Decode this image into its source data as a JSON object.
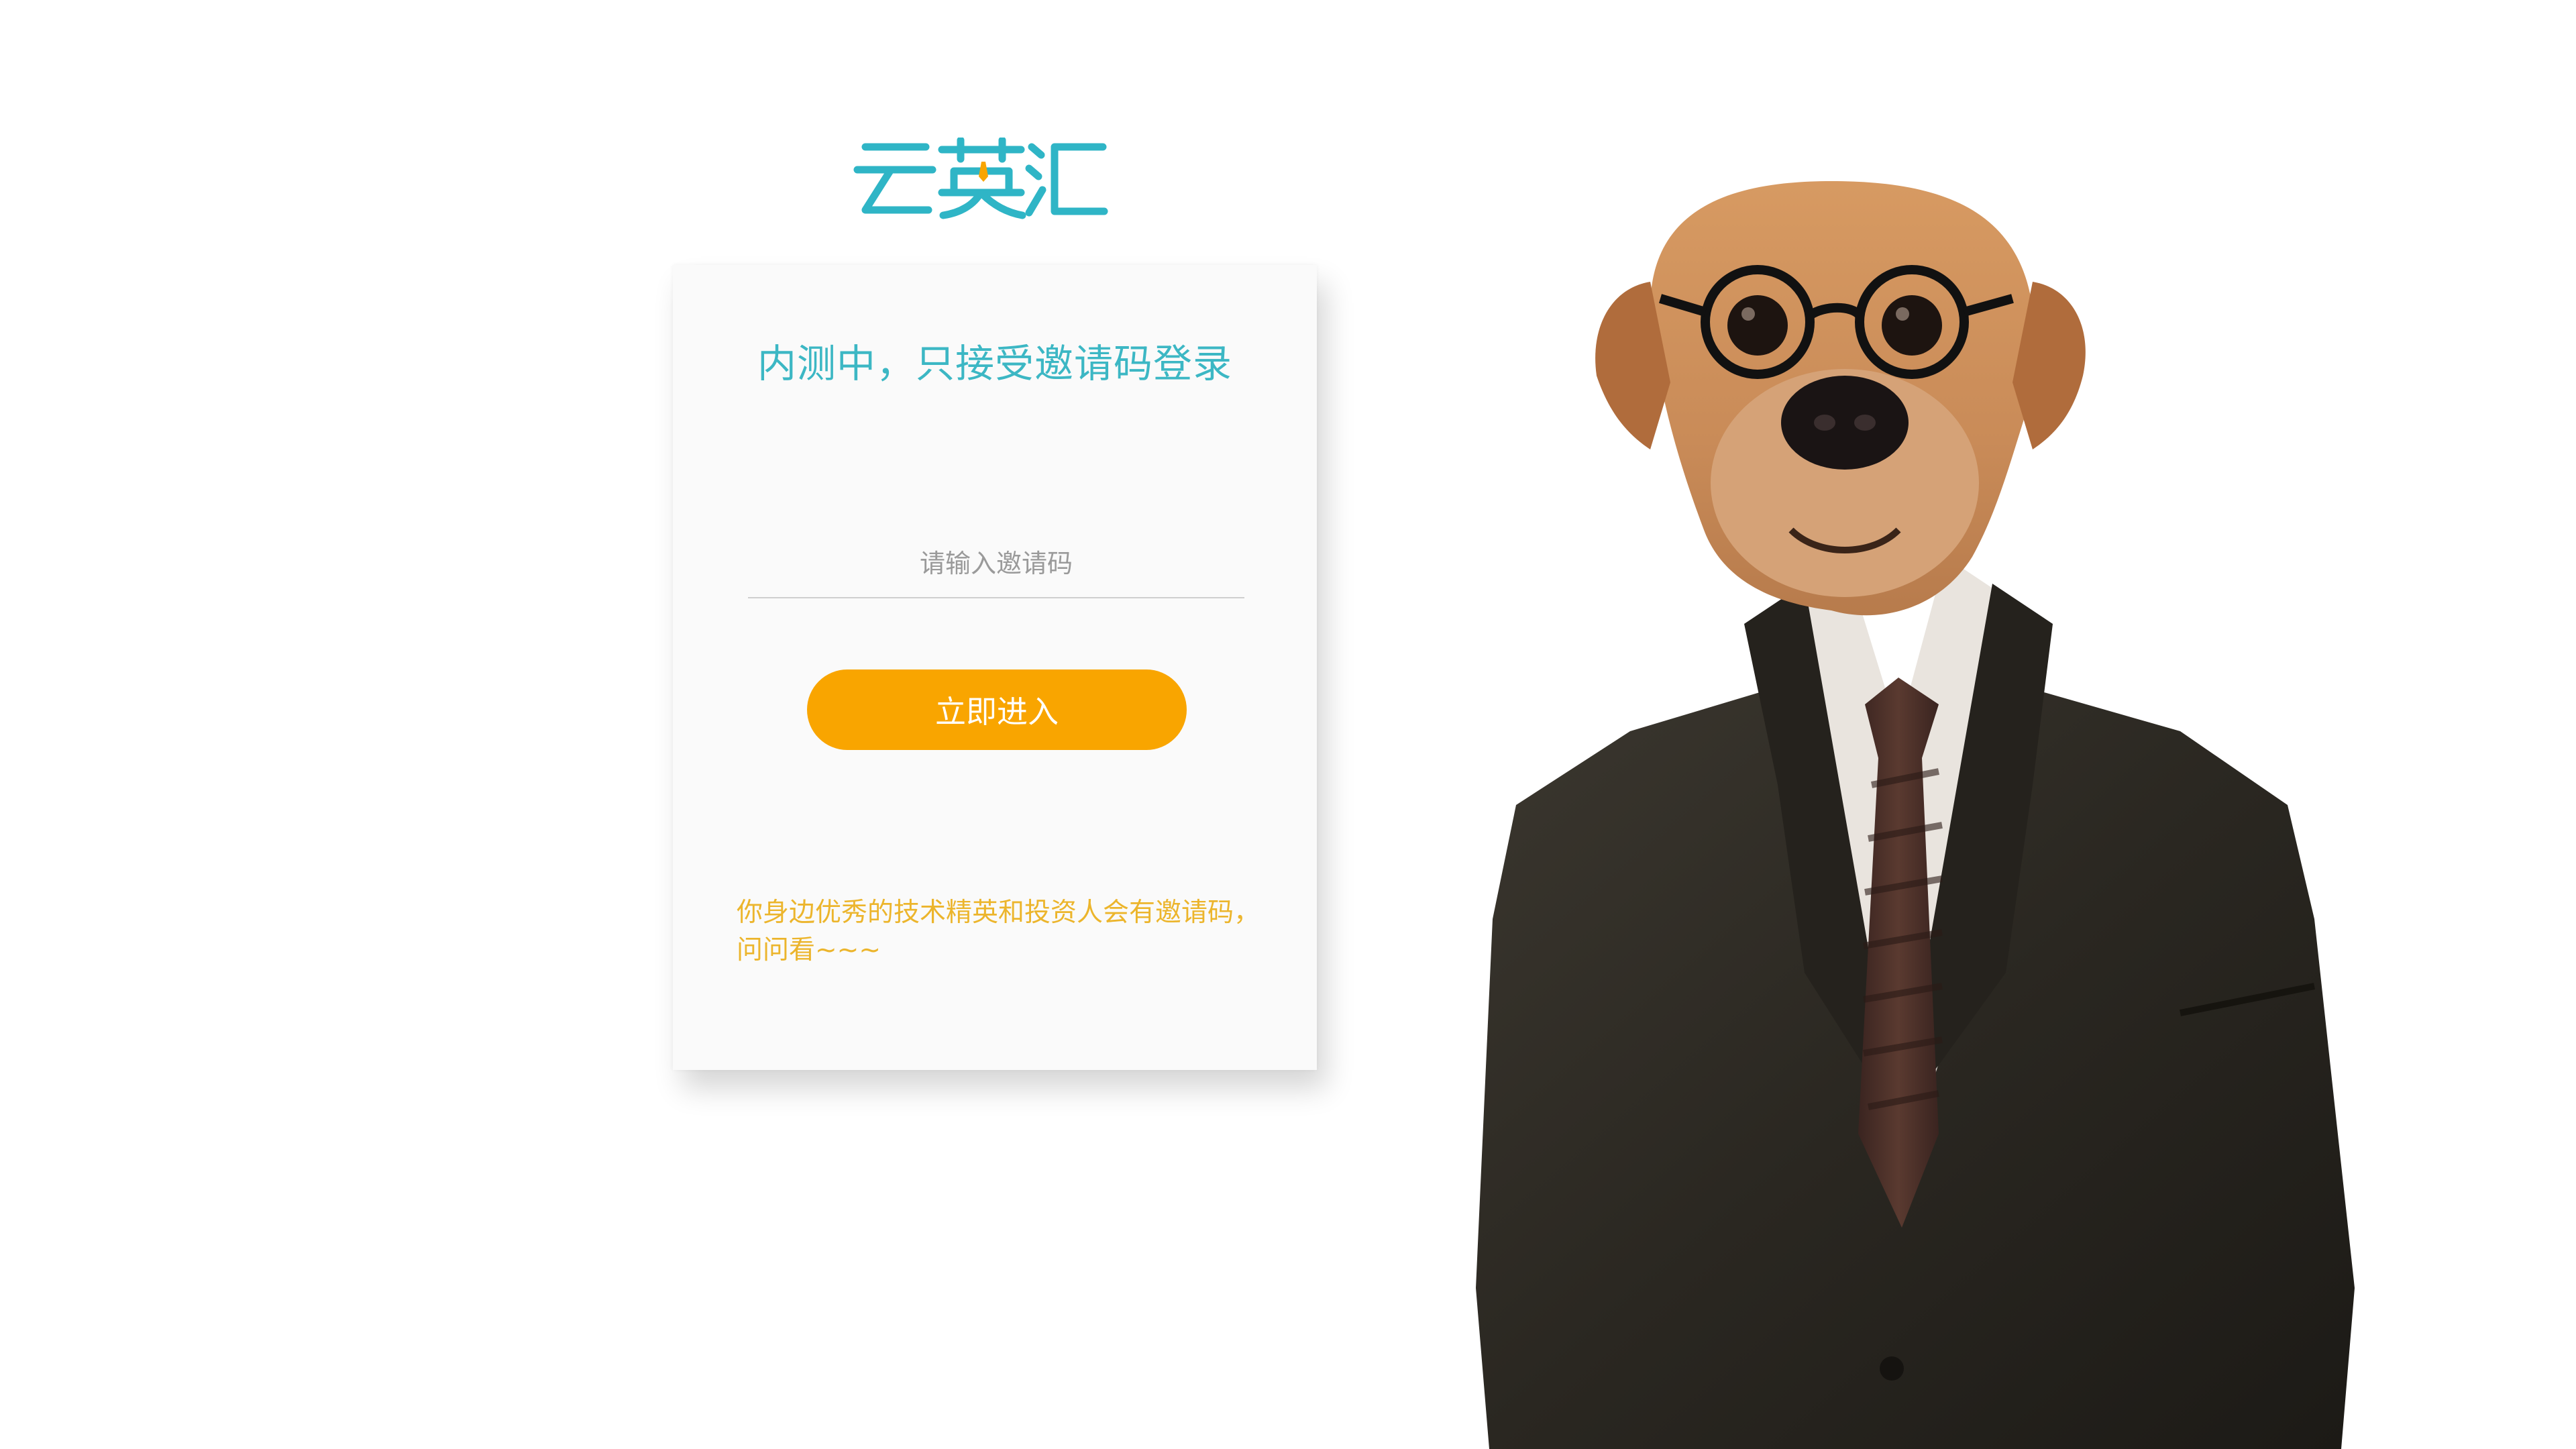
{
  "logo": {
    "text": "云英汇",
    "color": "#2fb5c6",
    "accent": "#f9a500"
  },
  "card": {
    "title": "内测中，只接受邀请码登录",
    "invite_input": {
      "placeholder": "请输入邀请码",
      "value": ""
    },
    "enter_button_label": "立即进入",
    "hint": "你身边优秀的技术精英和投资人会有邀请码，问问看~~~"
  },
  "colors": {
    "title": "#3cb7c4",
    "button": "#f9a500",
    "hint": "#ecb52c",
    "card_bg": "#fafafa"
  },
  "illustration": {
    "icon": "dog-in-suit-image",
    "description": ""
  }
}
